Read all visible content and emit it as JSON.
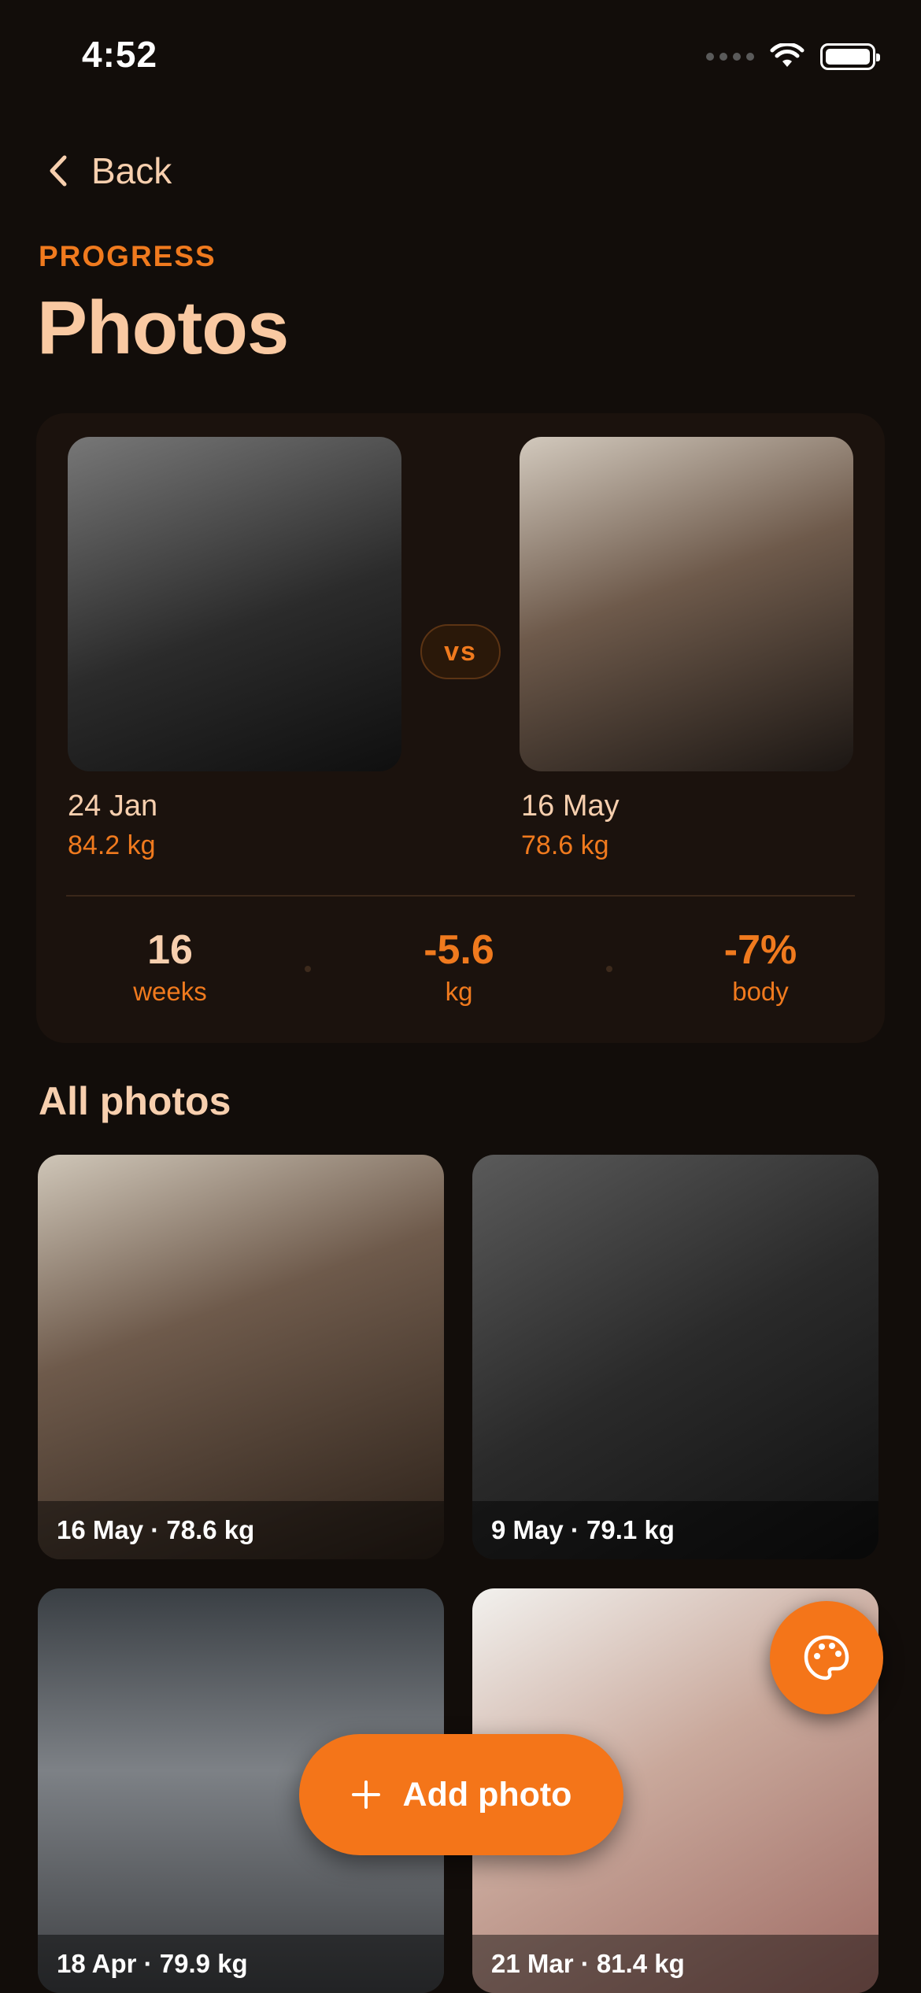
{
  "status_bar": {
    "time": "4:52"
  },
  "header": {
    "back_label": "Back",
    "eyebrow": "PROGRESS",
    "title": "Photos"
  },
  "compare": {
    "vs_label": "vs",
    "before": {
      "date": "24 Jan",
      "weight": "84.2 kg"
    },
    "after": {
      "date": "16 May",
      "weight": "78.6 kg"
    },
    "stats": [
      {
        "value": "16",
        "label": "weeks",
        "value_color": "#f7cfae"
      },
      {
        "value": "-5.6",
        "label": "kg",
        "value_color": "#f07a1e"
      },
      {
        "value": "-7%",
        "label": "body",
        "value_color": "#f07a1e"
      }
    ]
  },
  "gallery": {
    "title": "All photos",
    "photos": [
      {
        "caption": "16 May · 78.6 kg"
      },
      {
        "caption": "9 May · 79.1 kg"
      },
      {
        "caption": "18 Apr · 79.9 kg"
      },
      {
        "caption": "21 Mar · 81.4 kg"
      }
    ]
  },
  "actions": {
    "add_photo_label": "Add photo",
    "theme_icon": "palette-icon"
  },
  "colors": {
    "accent": "#f47519",
    "background": "#120d0a",
    "text": "#f7cfae"
  }
}
